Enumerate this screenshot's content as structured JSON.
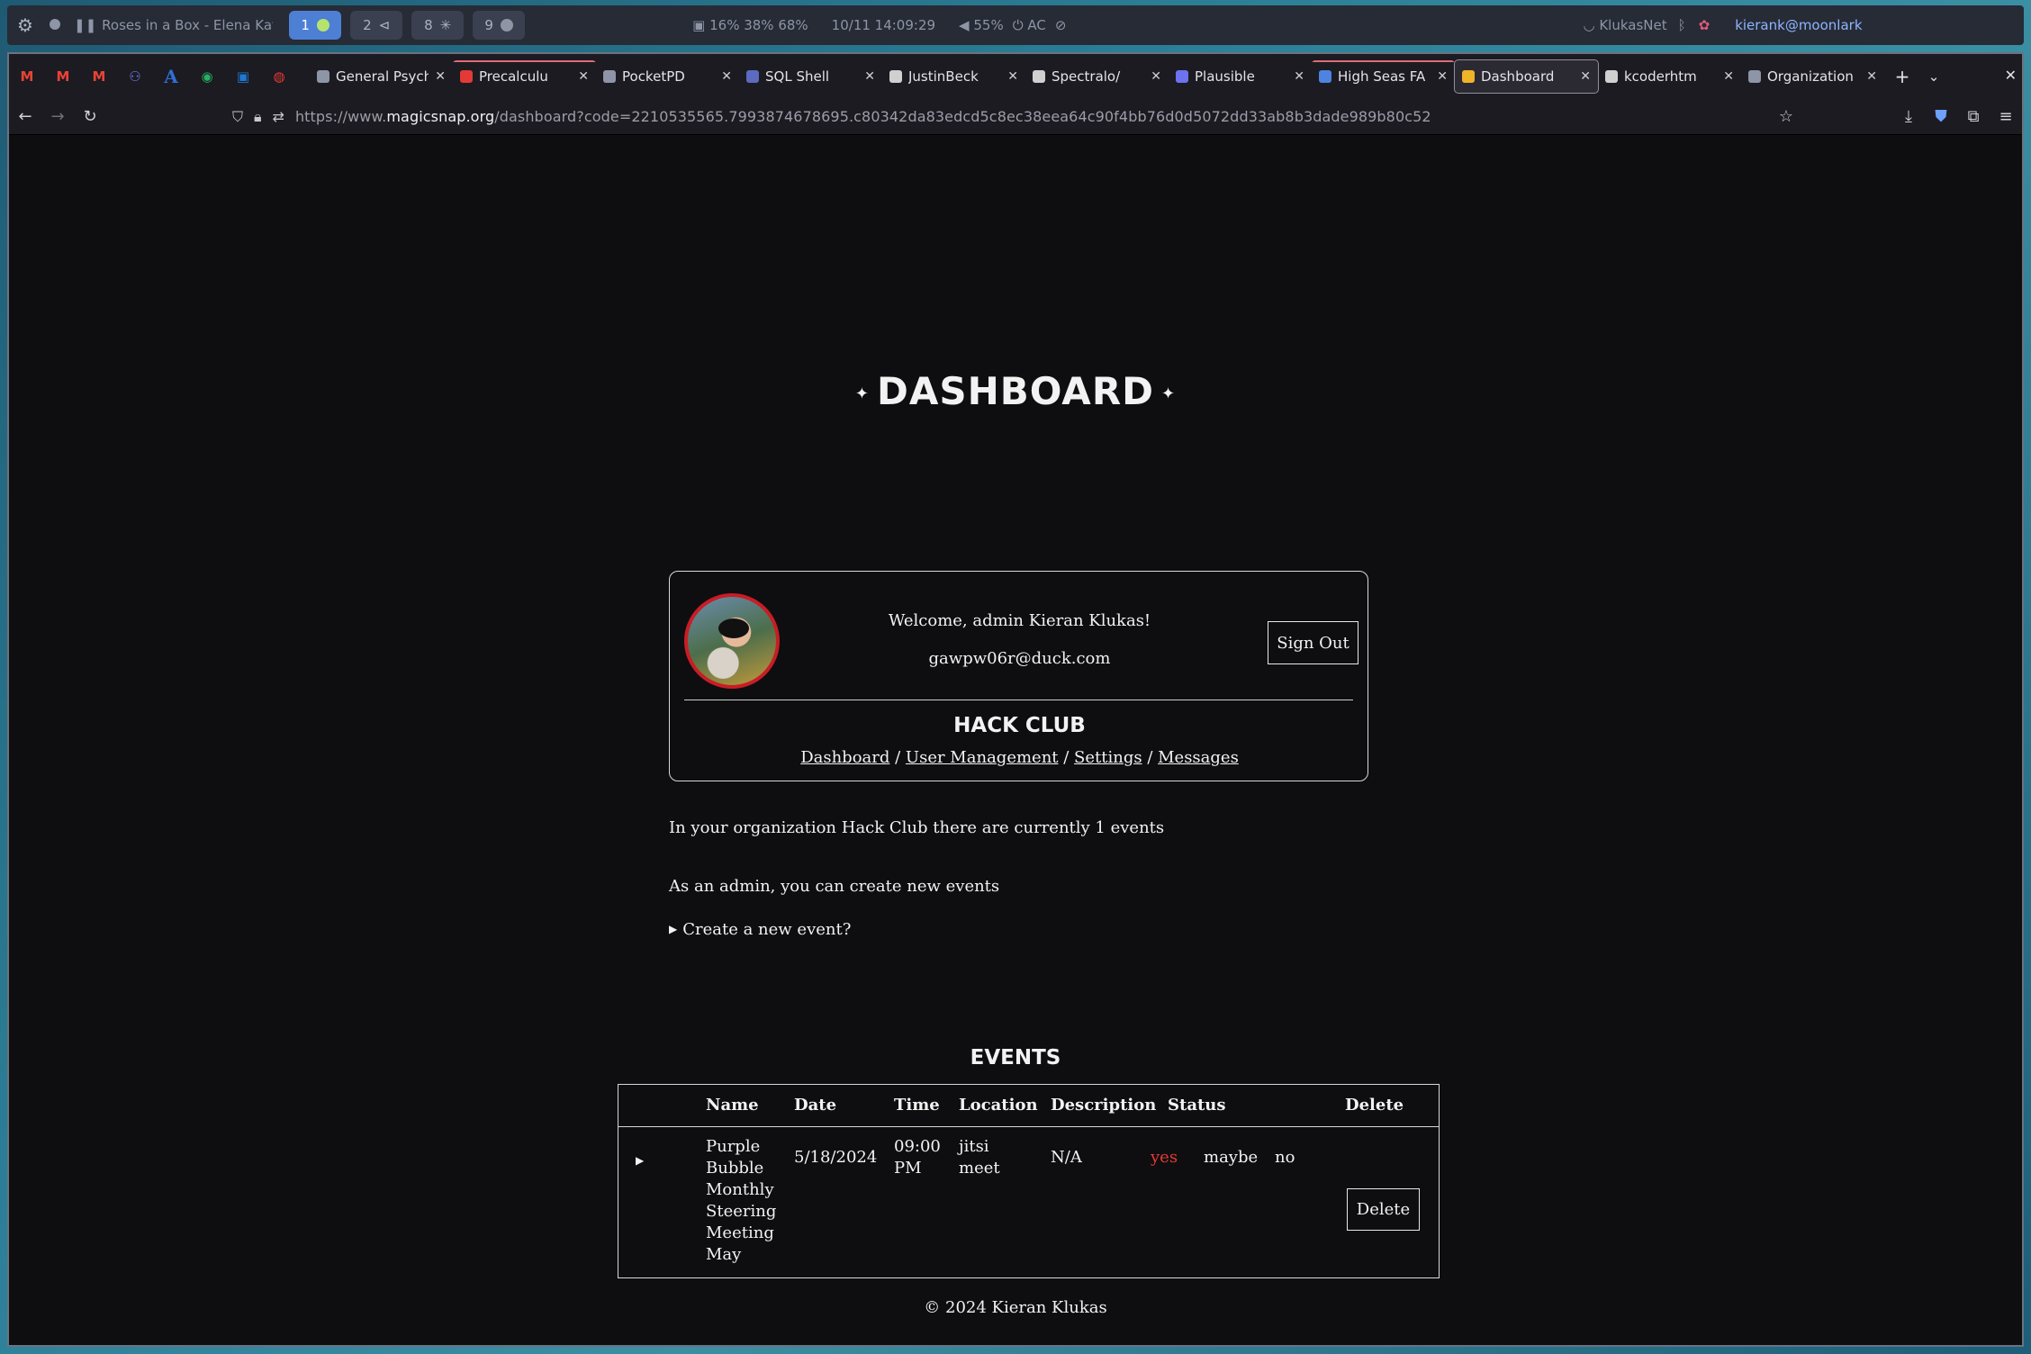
{
  "system_bar": {
    "media": "Roses in a Box - Elena Kats-Cher...",
    "workspaces": [
      "1",
      "2",
      "8",
      "9"
    ],
    "stats": "16%  38%  68%",
    "datetime": "10/11 14:09:29",
    "volume": "55%",
    "power": "AC",
    "network": "KlukasNet",
    "user": "kierank@moonlark"
  },
  "browser": {
    "tabs": [
      {
        "label": "General Psychol",
        "color": "#8d95a6"
      },
      {
        "label": "Precalculu",
        "color": "#e53935"
      },
      {
        "label": "PocketPD",
        "color": "#8d95a6"
      },
      {
        "label": "SQL Shell",
        "color": "#5c6bc0"
      },
      {
        "label": "JustinBeck",
        "color": "#d0d0d0"
      },
      {
        "label": "Spectralo/",
        "color": "#d0d0d0"
      },
      {
        "label": "Plausible",
        "color": "#6d72f0"
      },
      {
        "label": "High Seas FA",
        "color": "#4f83e0"
      },
      {
        "label": "Dashboard",
        "color": "#f0b429"
      },
      {
        "label": "kcoderhtm",
        "color": "#d0d0d0"
      },
      {
        "label": "Organization",
        "color": "#8d95a6"
      }
    ],
    "url_prefix": "https://www.",
    "url_host": "magicsnap.org",
    "url_rest": "/dashboard?code=2210535565.7993874678695.c80342da83edcd5c8ec38eea64c90f4bb76d0d5072dd33ab8b3dade989b80c52"
  },
  "page": {
    "title": "DASHBOARD",
    "welcome": "Welcome, admin Kieran Klukas!",
    "email": "gawpw06r@duck.com",
    "sign_out": "Sign Out",
    "org_name": "HACK CLUB",
    "nav": [
      "Dashboard",
      "User Management",
      "Settings",
      "Messages"
    ],
    "events_count_text": "In your organization Hack Club there are currently 1 events",
    "admin_text": "As an admin, you can create new events",
    "create_toggle": "Create a new event?",
    "events_heading": "EVENTS",
    "table": {
      "headers": [
        "Name",
        "Date",
        "Time",
        "Location",
        "Description",
        "Status",
        "Delete"
      ],
      "row": {
        "name": "Purple Bubble Monthly Steering Meeting May",
        "date": "5/18/2024",
        "time": "09:00 PM",
        "location": "jitsi meet",
        "description": "N/A",
        "status_yes": "yes",
        "status_maybe": "maybe",
        "status_no": "no",
        "delete": "Delete"
      }
    },
    "footer": "© 2024 Kieran Klukas",
    "colors": {
      "status_yes": "#e53935",
      "avatar_border": "#c81d25"
    }
  }
}
